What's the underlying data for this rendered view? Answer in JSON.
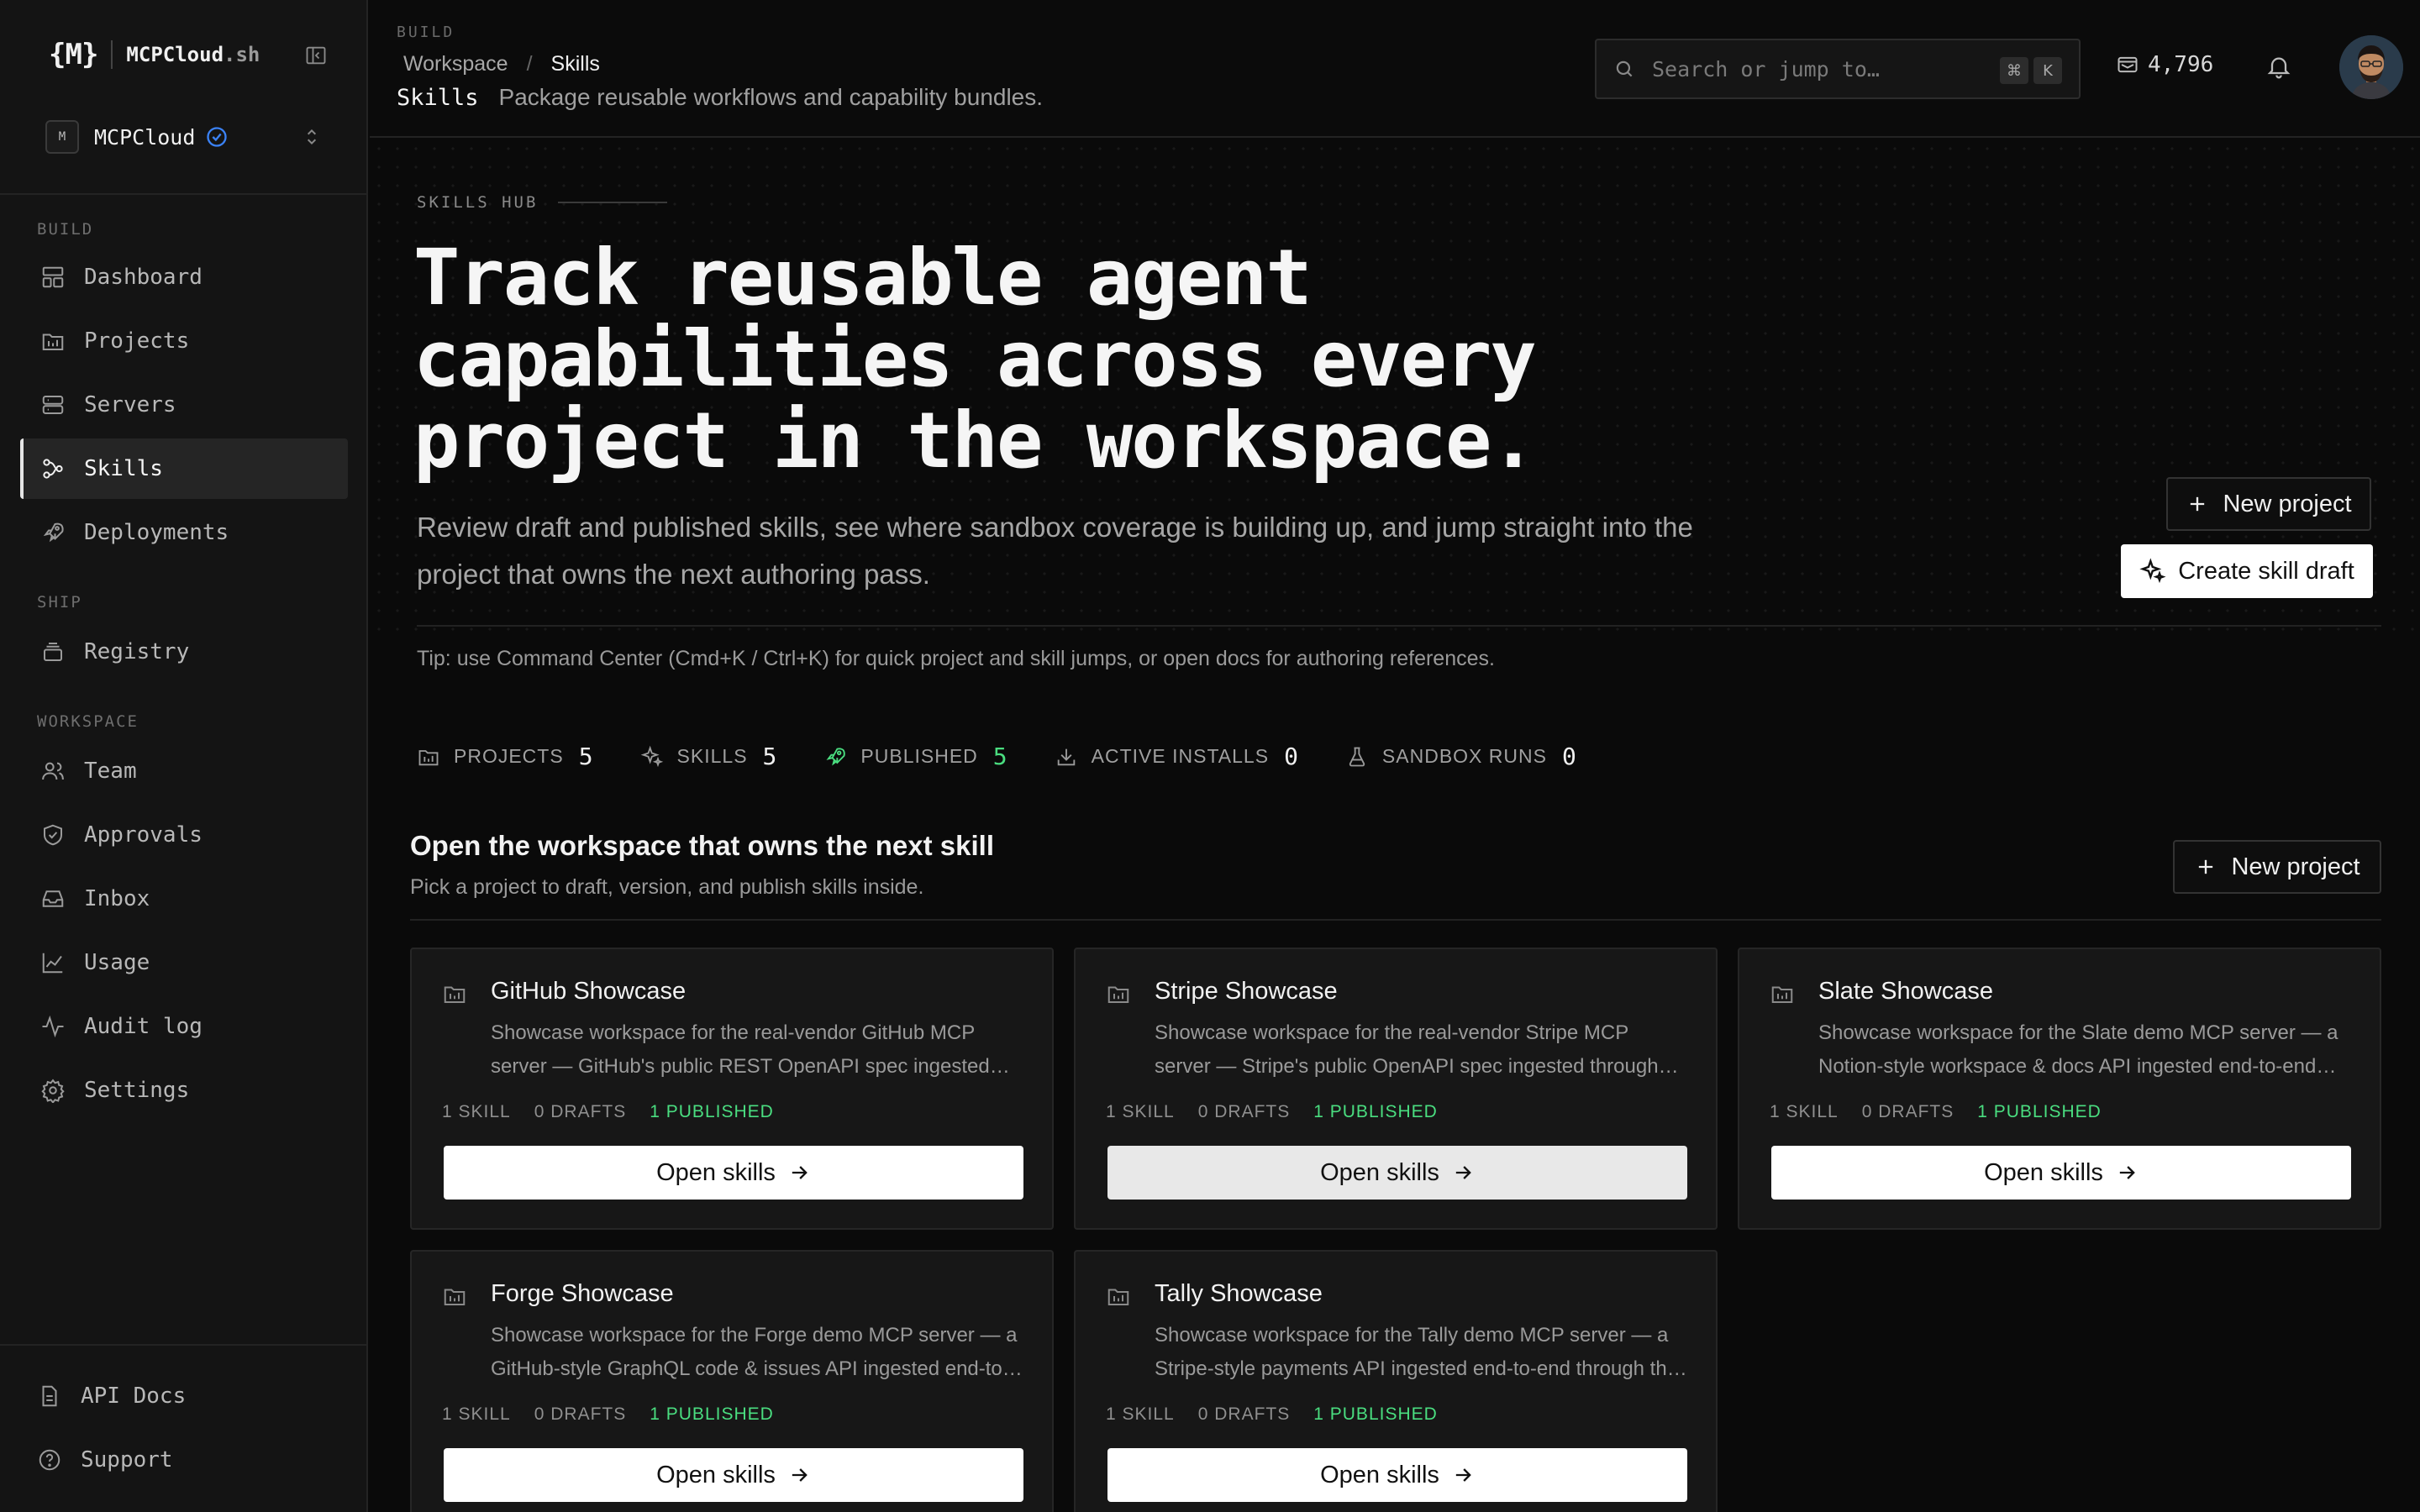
{
  "brand": {
    "logo": "{M}",
    "name": "MCPCloud",
    "suffix": ".sh"
  },
  "org": {
    "avatar": "M",
    "name": "MCPCloud"
  },
  "sidebar": {
    "sections": [
      "BUILD",
      "SHIP",
      "WORKSPACE"
    ],
    "build": [
      "Dashboard",
      "Projects",
      "Servers",
      "Skills",
      "Deployments"
    ],
    "ship": [
      "Registry"
    ],
    "workspace": [
      "Team",
      "Approvals",
      "Inbox",
      "Usage",
      "Audit log",
      "Settings"
    ],
    "footer": [
      "API Docs",
      "Support"
    ],
    "active": "Skills"
  },
  "header": {
    "section": "BUILD",
    "breadcrumb": [
      "Workspace",
      "/",
      "Skills"
    ],
    "title": "Skills",
    "subtitle": "Package reusable workflows and capability bundles.",
    "search_placeholder": "Search or jump to…",
    "kbd": [
      "⌘",
      "K"
    ],
    "credits": "4,796"
  },
  "hero": {
    "eyebrow": "SKILLS HUB",
    "headline_lines": [
      "Track reusable agent",
      "capabilities across every",
      "project in the workspace."
    ],
    "lede": "Review draft and published skills, see where sandbox coverage is building up, and jump straight into the project that owns the next authoring pass.",
    "new_project": "New project",
    "create_draft": "Create skill draft",
    "tip": "Tip: use Command Center (Cmd+K / Ctrl+K) for quick project and skill jumps, or open docs for authoring references."
  },
  "stats": [
    {
      "label": "PROJECTS",
      "value": "5",
      "icon": "folder-icon"
    },
    {
      "label": "SKILLS",
      "value": "5",
      "icon": "sparkles-icon"
    },
    {
      "label": "PUBLISHED",
      "value": "5",
      "icon": "rocket-icon"
    },
    {
      "label": "ACTIVE INSTALLS",
      "value": "0",
      "icon": "download-icon"
    },
    {
      "label": "SANDBOX RUNS",
      "value": "0",
      "icon": "flask-icon"
    }
  ],
  "section": {
    "title": "Open the workspace that owns the next skill",
    "subtitle": "Pick a project to draft, version, and publish skills inside.",
    "new_project": "New project"
  },
  "projects": [
    {
      "name": "GitHub Showcase",
      "desc": "Showcase workspace for the real-vendor GitHub MCP server — GitHub's public REST OpenAPI spec ingested end-to-end through the pipeline.",
      "skills": "1 SKILL",
      "drafts": "0 DRAFTS",
      "published": "1 PUBLISHED",
      "cta": "Open skills"
    },
    {
      "name": "Stripe Showcase",
      "desc": "Showcase workspace for the real-vendor Stripe MCP server — Stripe's public OpenAPI spec ingested through the pipeline.",
      "skills": "1 SKILL",
      "drafts": "0 DRAFTS",
      "published": "1 PUBLISHED",
      "cta": "Open skills"
    },
    {
      "name": "Slate Showcase",
      "desc": "Showcase workspace for the Slate demo MCP server — a Notion-style workspace & docs API ingested end-to-end through the pipeline.",
      "skills": "1 SKILL",
      "drafts": "0 DRAFTS",
      "published": "1 PUBLISHED",
      "cta": "Open skills"
    },
    {
      "name": "Forge Showcase",
      "desc": "Showcase workspace for the Forge demo MCP server — a GitHub-style GraphQL code & issues API ingested end-to-end through the pipeline.",
      "skills": "1 SKILL",
      "drafts": "0 DRAFTS",
      "published": "1 PUBLISHED",
      "cta": "Open skills"
    },
    {
      "name": "Tally Showcase",
      "desc": "Showcase workspace for the Tally demo MCP server — a Stripe-style payments API ingested end-to-end through the pipeline.",
      "skills": "1 SKILL",
      "drafts": "0 DRAFTS",
      "published": "1 PUBLISHED",
      "cta": "Open skills"
    }
  ],
  "colors": {
    "accent_green": "#4ade80",
    "verified_blue": "#3b82f6",
    "bg": "#0a0a0a",
    "sidebar_bg": "#141414"
  }
}
